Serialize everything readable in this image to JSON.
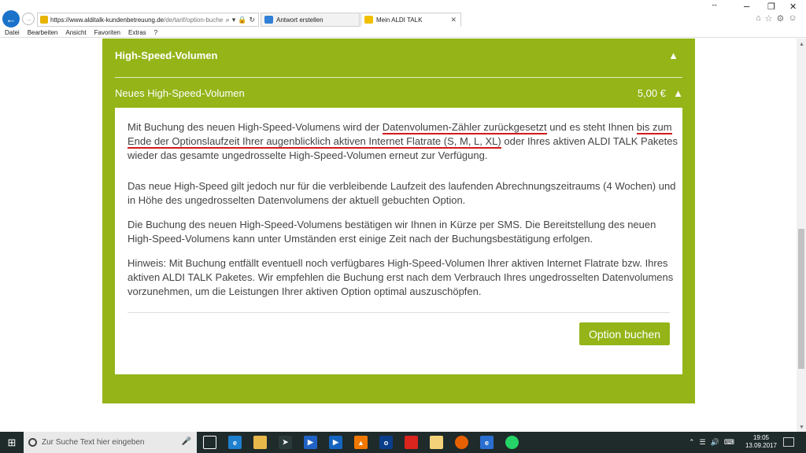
{
  "browser": {
    "url_host": "https://www.alditalk-kundenbetreuung.de",
    "url_path": "/de/tarif/option-buche",
    "tabs": [
      {
        "label": "Antwort erstellen"
      },
      {
        "label": "Mein ALDI TALK"
      }
    ],
    "menu": [
      "Datei",
      "Bearbeiten",
      "Ansicht",
      "Favoriten",
      "Extras",
      "?"
    ]
  },
  "page": {
    "section_title": "High-Speed-Volumen",
    "sub_title": "Neues High-Speed-Volumen",
    "price": "5,00 €",
    "p1": {
      "a": "Mit Buchung des neuen High-Speed-Volumens wird der ",
      "hl1": "Datenvolumen-Zähler zurückgesetzt",
      "b": " und es steht Ihnen ",
      "hl2": "bis zum Ende der Optionslaufzeit Ihrer augenblicklich aktiven Internet Flatrate (S, M, L, XL)",
      "c": " oder Ihres aktiven ALDI TALK Paketes wieder das gesamte ungedrosselte High-Speed-Volumen erneut zur Verfügung."
    },
    "p2": "Das neue High-Speed gilt jedoch nur für die verbleibende Laufzeit des laufenden Abrechnungszeitraums (4 Wochen) und in Höhe des ungedrosselten Datenvolumens der aktuell gebuchten Option.",
    "p3": "Die Buchung des neuen High-Speed-Volumens bestätigen wir Ihnen in Kürze per SMS. Die Bereitstellung des neuen High-Speed-Volumens kann unter Umständen erst einige Zeit nach der Buchungsbestätigung erfolgen.",
    "p4": "Hinweis: Mit Buchung entfällt eventuell noch verfügbares High-Speed-Volumen Ihrer aktiven Internet Flatrate bzw. Ihres aktiven ALDI TALK Paketes. Wir empfehlen die Buchung erst nach dem Verbrauch Ihres ungedrosselten Datenvolumens vorzunehmen, um die Leistungen Ihrer aktiven Option optimal auszuschöpfen.",
    "button_label": "Option buchen",
    "accent_color": "#94b418",
    "highlight_color": "#d11a1a"
  },
  "taskbar": {
    "search_placeholder": "Zur Suche Text hier eingeben",
    "time": "19:05",
    "date": "13.09.2017",
    "apps": [
      "task-view-icon",
      "edge-icon",
      "file-explorer-icon",
      "app-icon",
      "media-player-icon",
      "video-icon",
      "vlc-icon",
      "outlook-icon",
      "red-app-icon",
      "paint-icon",
      "firefox-icon",
      "internet-explorer-icon",
      "whatsapp-icon"
    ]
  }
}
